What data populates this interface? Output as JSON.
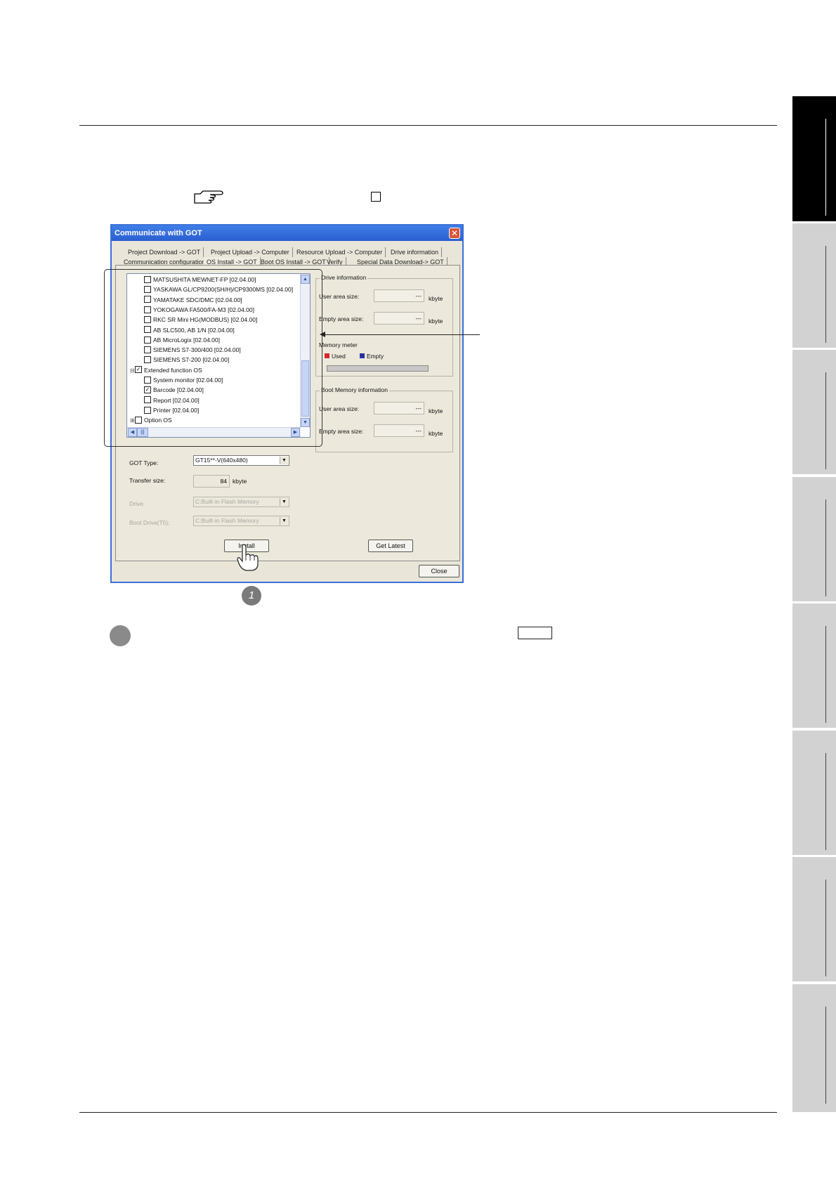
{
  "dialog": {
    "title": "Communicate with GOT",
    "close_glyph": "✕",
    "tabs_row1": [
      "Project Download -> GOT",
      "Project Upload -> Computer",
      "Resource Upload -> Computer",
      "Drive information"
    ],
    "tabs_row2": [
      "Communication configuration",
      "OS Install -> GOT",
      "Boot OS Install -> GOT",
      "Verify",
      "Special Data Download-> GOT"
    ],
    "selected_tab": "OS Install -> GOT",
    "tree": [
      {
        "label": "MATSUSHITA MEWNET-FP [02.04.00]",
        "checked": false,
        "level": 2
      },
      {
        "label": "YASKAWA GL/CP9200(SH/H)/CP9300MS [02.04.00]",
        "checked": false,
        "level": 2
      },
      {
        "label": "YAMATAKE SDC/DMC [02.04.00]",
        "checked": false,
        "level": 2
      },
      {
        "label": "YOKOGAWA FA500/FA-M3 [02.04.00]",
        "checked": false,
        "level": 2
      },
      {
        "label": "RKC SR Mini HG(MODBUS) [02.04.00]",
        "checked": false,
        "level": 2
      },
      {
        "label": "AB SLC500, AB 1/N [02.04.00]",
        "checked": false,
        "level": 2
      },
      {
        "label": "AB MicroLogix [02.04.00]",
        "checked": false,
        "level": 2
      },
      {
        "label": "SIEMENS S7-300/400 [02.04.00]",
        "checked": false,
        "level": 2
      },
      {
        "label": "SIEMENS S7-200 [02.04.00]",
        "checked": false,
        "level": 2
      },
      {
        "label": "Extended function OS",
        "checked": true,
        "level": 1,
        "expander": "⊟"
      },
      {
        "label": "System monitor [02.04.00]",
        "checked": false,
        "level": 2
      },
      {
        "label": "Barcode [02.04.00]",
        "checked": true,
        "level": 2
      },
      {
        "label": "Report [02.04.00]",
        "checked": false,
        "level": 2
      },
      {
        "label": "Printer [02.04.00]",
        "checked": false,
        "level": 2
      },
      {
        "label": "Option OS",
        "checked": false,
        "level": 1,
        "expander": "⊞"
      }
    ],
    "drive_info": {
      "title": "Drive information",
      "user_area_label": "User area size:",
      "user_area_value": "---",
      "empty_area_label": "Empty area size:",
      "empty_area_value": "---",
      "unit": "kbyte",
      "memory_meter_label": "Memory meter",
      "legend_used": "Used",
      "legend_empty": "Empty",
      "used_color": "#d6262b",
      "empty_color": "#2b2f9e"
    },
    "boot_memory_info": {
      "title": "Boot Memory information",
      "user_area_label": "User area size:",
      "user_area_value": "---",
      "empty_area_label": "Empty area size:",
      "empty_area_value": "---",
      "unit": "kbyte"
    },
    "got_type_label": "GOT Type:",
    "got_type_value": "GT15**-V(640x480)",
    "transfer_size_label": "Transfer size:",
    "transfer_size_value": "84",
    "transfer_size_unit": "kbyte",
    "drive_label": "Drive:",
    "drive_value": "C:Built-in Flash Memory",
    "boot_drive_label": "Boot Drive(T5):",
    "boot_drive_value": "C:Built-in Flash Memory",
    "install_button": "Install",
    "get_latest_button": "Get Latest",
    "close_button": "Close"
  },
  "step_marker": "1",
  "colors": {
    "title_bar": "#2a5ed0",
    "dialog_bg": "#e9e6d9",
    "side_tab": "#d2d2d2",
    "side_tab_active": "#000000"
  }
}
